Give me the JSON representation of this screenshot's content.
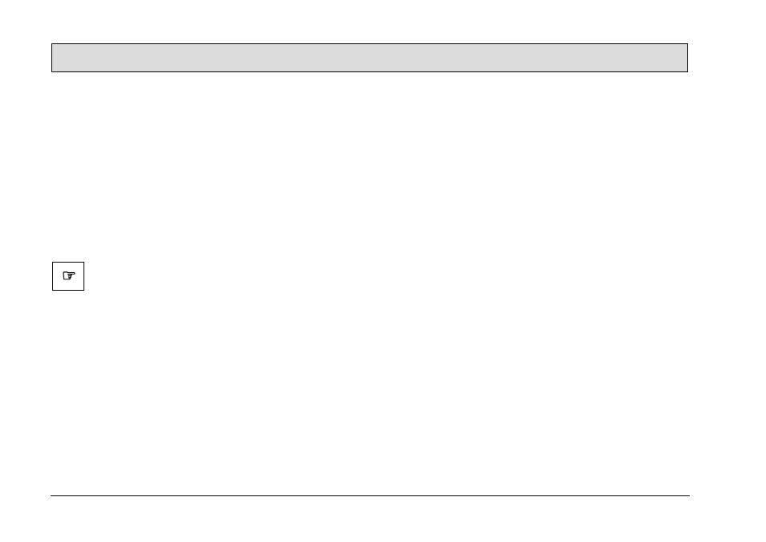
{
  "note_icon": "☞"
}
